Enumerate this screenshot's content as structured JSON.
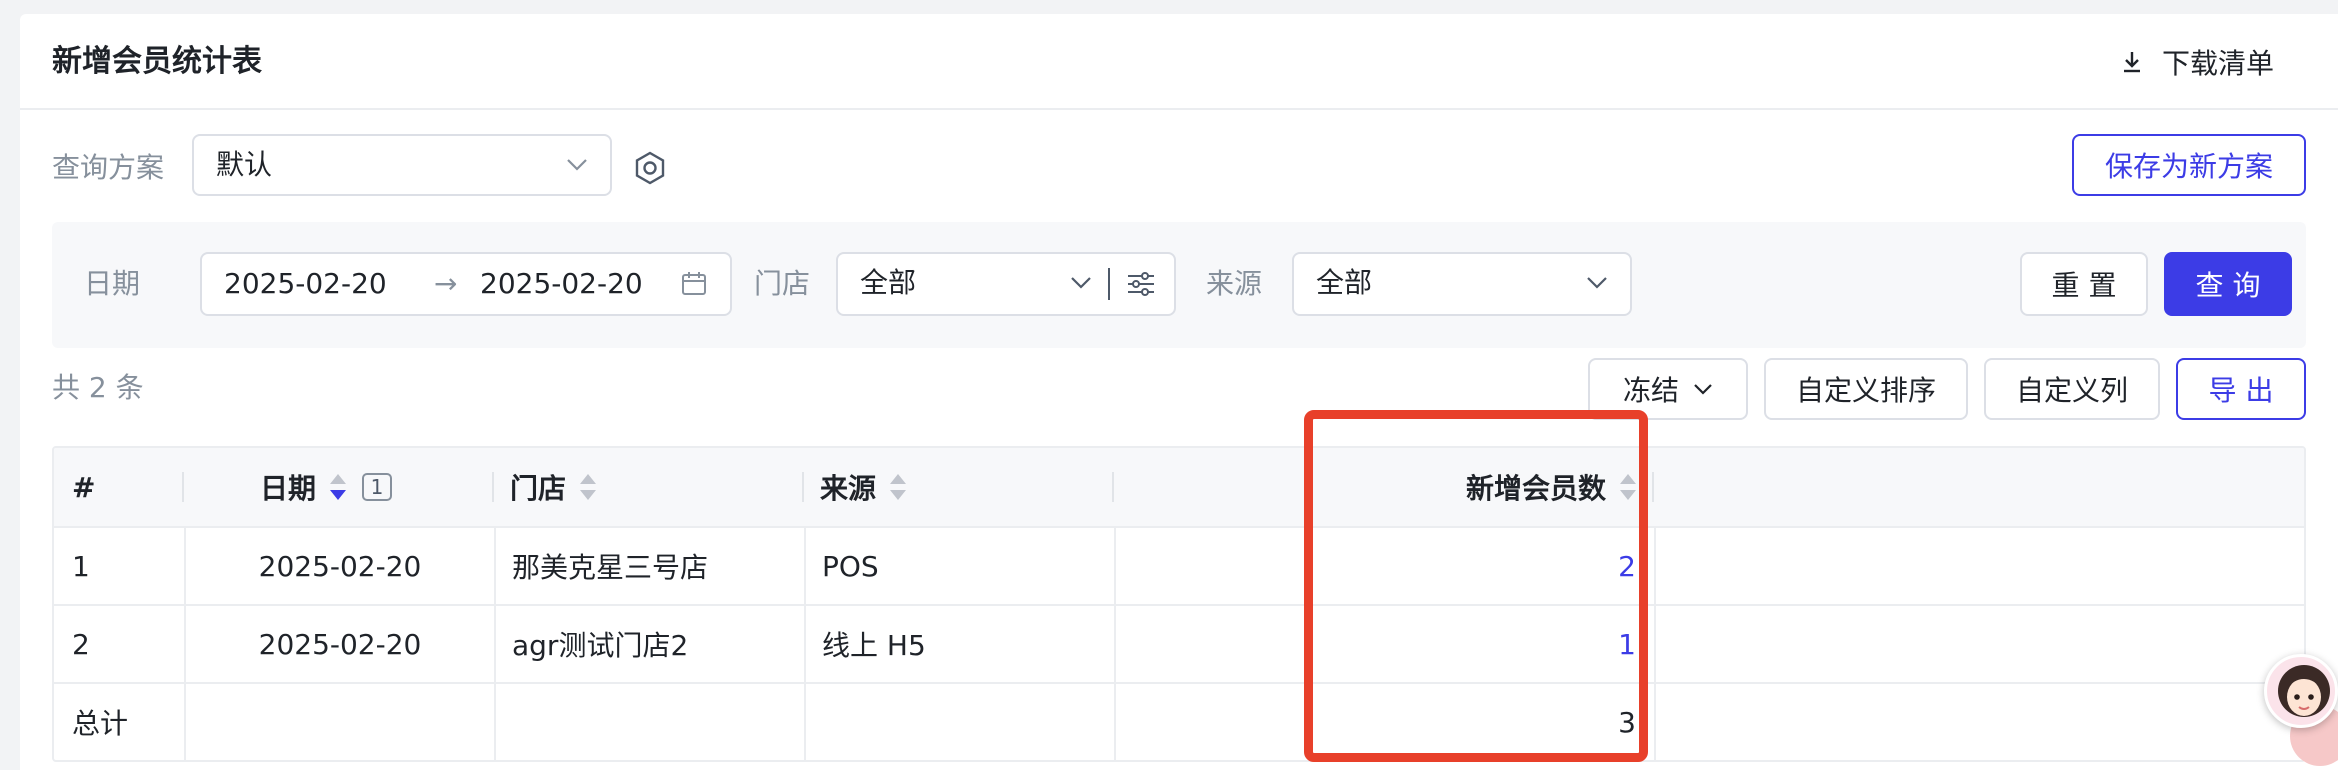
{
  "header": {
    "title": "新增会员统计表",
    "download_label": "下载清单"
  },
  "plan": {
    "label": "查询方案",
    "selected": "默认",
    "save_label": "保存为新方案"
  },
  "filters": {
    "date_label": "日期",
    "date_start": "2025-02-20",
    "date_end": "2025-02-20",
    "store_label": "门店",
    "store_value": "全部",
    "source_label": "来源",
    "source_value": "全部",
    "reset_label": "重 置",
    "query_label": "查 询"
  },
  "toolbar": {
    "count_text": "共 2 条",
    "freeze_label": "冻结",
    "custom_sort_label": "自定义排序",
    "custom_cols_label": "自定义列",
    "export_label": "导 出"
  },
  "table": {
    "headers": [
      "#",
      "日期",
      "门店",
      "来源",
      "新增会员数"
    ],
    "sort_badge": "1",
    "rows": [
      {
        "idx": "1",
        "date": "2025-02-20",
        "store": "那美克星三号店",
        "source": "POS",
        "new_members": "2"
      },
      {
        "idx": "2",
        "date": "2025-02-20",
        "store": "agr测试门店2",
        "source": "线上 H5",
        "new_members": "1"
      }
    ],
    "total": {
      "label": "总计",
      "new_members": "3"
    }
  },
  "colors": {
    "accent": "#3c3ce6",
    "highlight": "#e8402a"
  }
}
